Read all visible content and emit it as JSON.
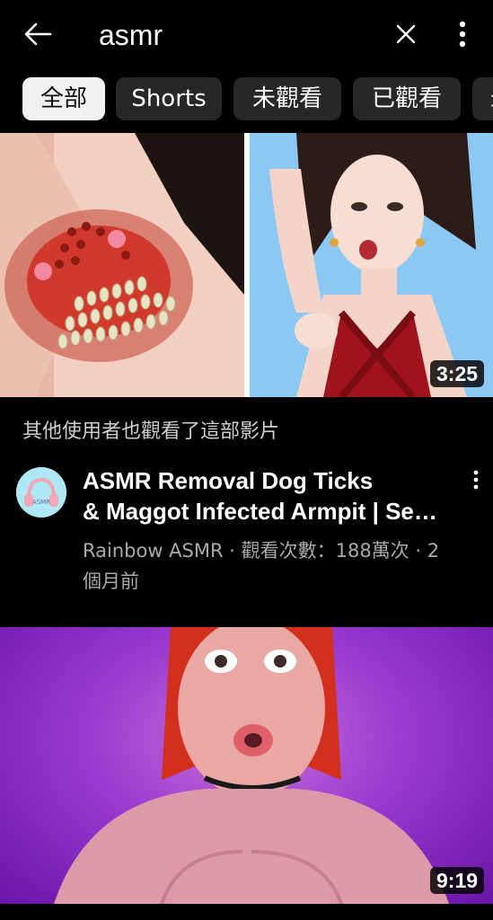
{
  "search": {
    "query": "asmr"
  },
  "filters": [
    {
      "label": "全部",
      "active": true
    },
    {
      "label": "Shorts",
      "active": false
    },
    {
      "label": "未觀看",
      "active": false
    },
    {
      "label": "已觀看",
      "active": false
    },
    {
      "label": "最",
      "active": false
    }
  ],
  "videos": [
    {
      "duration": "3:25"
    },
    {
      "duration": "9:19"
    }
  ],
  "section": {
    "also_watched_label": "其他使用者也觀看了這部影片"
  },
  "featured_video": {
    "title_line1": "ASMR Removal Dog Ticks",
    "title_line2": "& Maggot Infected Armpit | Se…",
    "meta_line1": "Rainbow ASMR · 觀看次數：188萬次 · 2",
    "meta_line2": "個月前",
    "avatar_text": "ASMR"
  },
  "icons": {
    "back": "arrow-left-icon",
    "clear": "close-icon",
    "more": "more-vertical-icon"
  }
}
